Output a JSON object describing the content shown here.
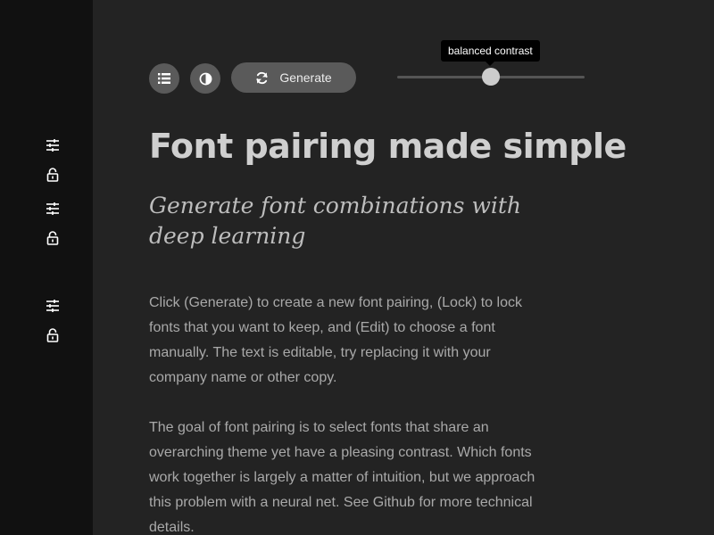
{
  "sidebar": {
    "icons": [
      {
        "icon": "sliders-icon",
        "action": "edit"
      },
      {
        "icon": "lock-icon",
        "action": "lock"
      },
      {
        "icon": "sliders-icon",
        "action": "edit"
      },
      {
        "icon": "lock-icon",
        "action": "lock"
      },
      {
        "icon": "sliders-icon",
        "action": "edit"
      },
      {
        "icon": "lock-icon",
        "action": "lock"
      }
    ]
  },
  "toolbar": {
    "list_icon": "list-icon",
    "contrast_icon": "contrast-icon",
    "generate_icon": "refresh-icon",
    "generate_label": "Generate",
    "slider_tooltip": "balanced contrast",
    "slider_value": 0.5
  },
  "content": {
    "heading": "Font pairing made simple",
    "subheading": "Generate font combinations with deep learning",
    "paragraph_1": "Click (Generate) to create a new font pairing, (Lock) to lock fonts that you want to keep, and (Edit) to choose a font manually. The text is editable, try replacing it with your company name or other copy.",
    "paragraph_2": "The goal of font pairing is to select fonts that share an overarching theme yet have a pleasing contrast. Which fonts work together is largely a matter of intuition, but we approach this problem with a neural net. See Github for more technical details."
  },
  "colors": {
    "background": "#232323",
    "sidebar": "#111111",
    "button": "#5a5a5a",
    "heading": "#cfcfcf",
    "body_text": "#a9a9a9"
  }
}
